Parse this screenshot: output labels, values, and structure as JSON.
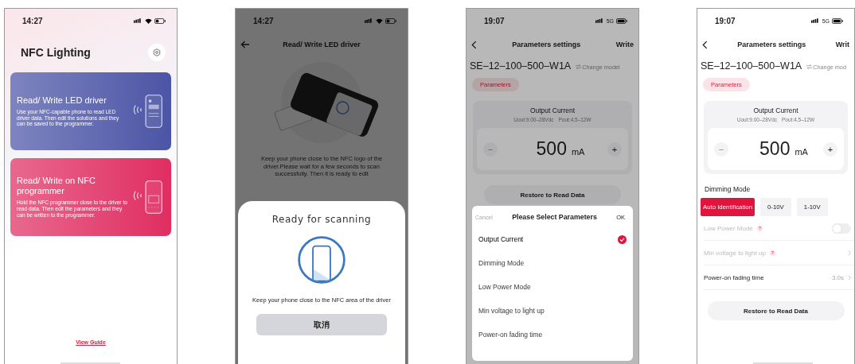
{
  "screens": [
    {
      "kind": "home",
      "status": {
        "time": "14:27"
      },
      "title": "NFC Lighting",
      "cards": [
        {
          "title": "Read/ Write LED driver",
          "description": "Use your NFC-capable phone to read LED driver data. Then edit the solutions and they can be saved to the programmer.",
          "color": "#4c55a6"
        },
        {
          "title": "Read/ Write on NFC programmer",
          "description": "Hold the NFC programmer close to the driver to read data. Then edit the parameters and they can be written to the programmer.",
          "color": "#e02e61"
        }
      ],
      "guide_link": "View Guide"
    },
    {
      "kind": "scan",
      "status": {
        "time": "14:27"
      },
      "title": "Read/ Write LED driver",
      "instructions": "Keep your phone close to the NFC logo of the driver.Please wait for a few seconds to scan successfully. Then it is ready to edit",
      "sheet": {
        "title": "Ready for scanning",
        "message": "Keep your phone close to the NFC area of the driver",
        "cancel": "取消"
      }
    },
    {
      "kind": "params",
      "status": {
        "time": "19:07",
        "network": "5G"
      },
      "title": "Parameters settings",
      "action": "Write",
      "model": "SE–12–100–500–W1A",
      "change_model": "Change model",
      "tab": "Parameters",
      "output": {
        "label": "Output Current",
        "specs": [
          "Uout:9.00–28Vdc",
          "Pout:4.5–12W"
        ],
        "minus": "−",
        "value": "500",
        "unit": "mA",
        "plus": "+"
      },
      "restore": "Restore to Read Data",
      "picker": {
        "cancel": "Cancel",
        "title": "Please Select Parameters",
        "ok": "OK",
        "options": [
          {
            "label": "Output Current",
            "selected": true
          },
          {
            "label": "Dimming Mode",
            "selected": false
          },
          {
            "label": "Low Power Mode",
            "selected": false
          },
          {
            "label": "Min voltage to light up",
            "selected": false
          },
          {
            "label": "Power-on fading time",
            "selected": false
          }
        ]
      }
    },
    {
      "kind": "params",
      "status": {
        "time": "19:07",
        "network": "5G"
      },
      "title": "Parameters settings",
      "action": "Writ",
      "model": "SE–12–100–500–W1A",
      "change_model": "Change mod",
      "tab": "Parameters",
      "output": {
        "label": "Output Current",
        "specs": [
          "Uout:9.00–28Vdc",
          "Pout:4.5–12W"
        ],
        "minus": "−",
        "value": "500",
        "unit": "mA",
        "plus": "+"
      },
      "dimming": {
        "label": "Dimming Mode",
        "options": [
          {
            "label": "Auto Identification",
            "selected": true
          },
          {
            "label": "0-10V",
            "selected": false
          },
          {
            "label": "1-10V",
            "selected": false
          }
        ]
      },
      "rows": [
        {
          "kind": "toggle",
          "label": "Low Power Mode",
          "help": "?",
          "disabled": true,
          "on": false
        },
        {
          "kind": "link",
          "label": "Min voltage to light up",
          "help": "?",
          "disabled": true
        },
        {
          "kind": "link",
          "label": "Power-on fading time",
          "value": "3.0s",
          "disabled": false
        }
      ],
      "restore": "Restore to Read Data"
    }
  ]
}
